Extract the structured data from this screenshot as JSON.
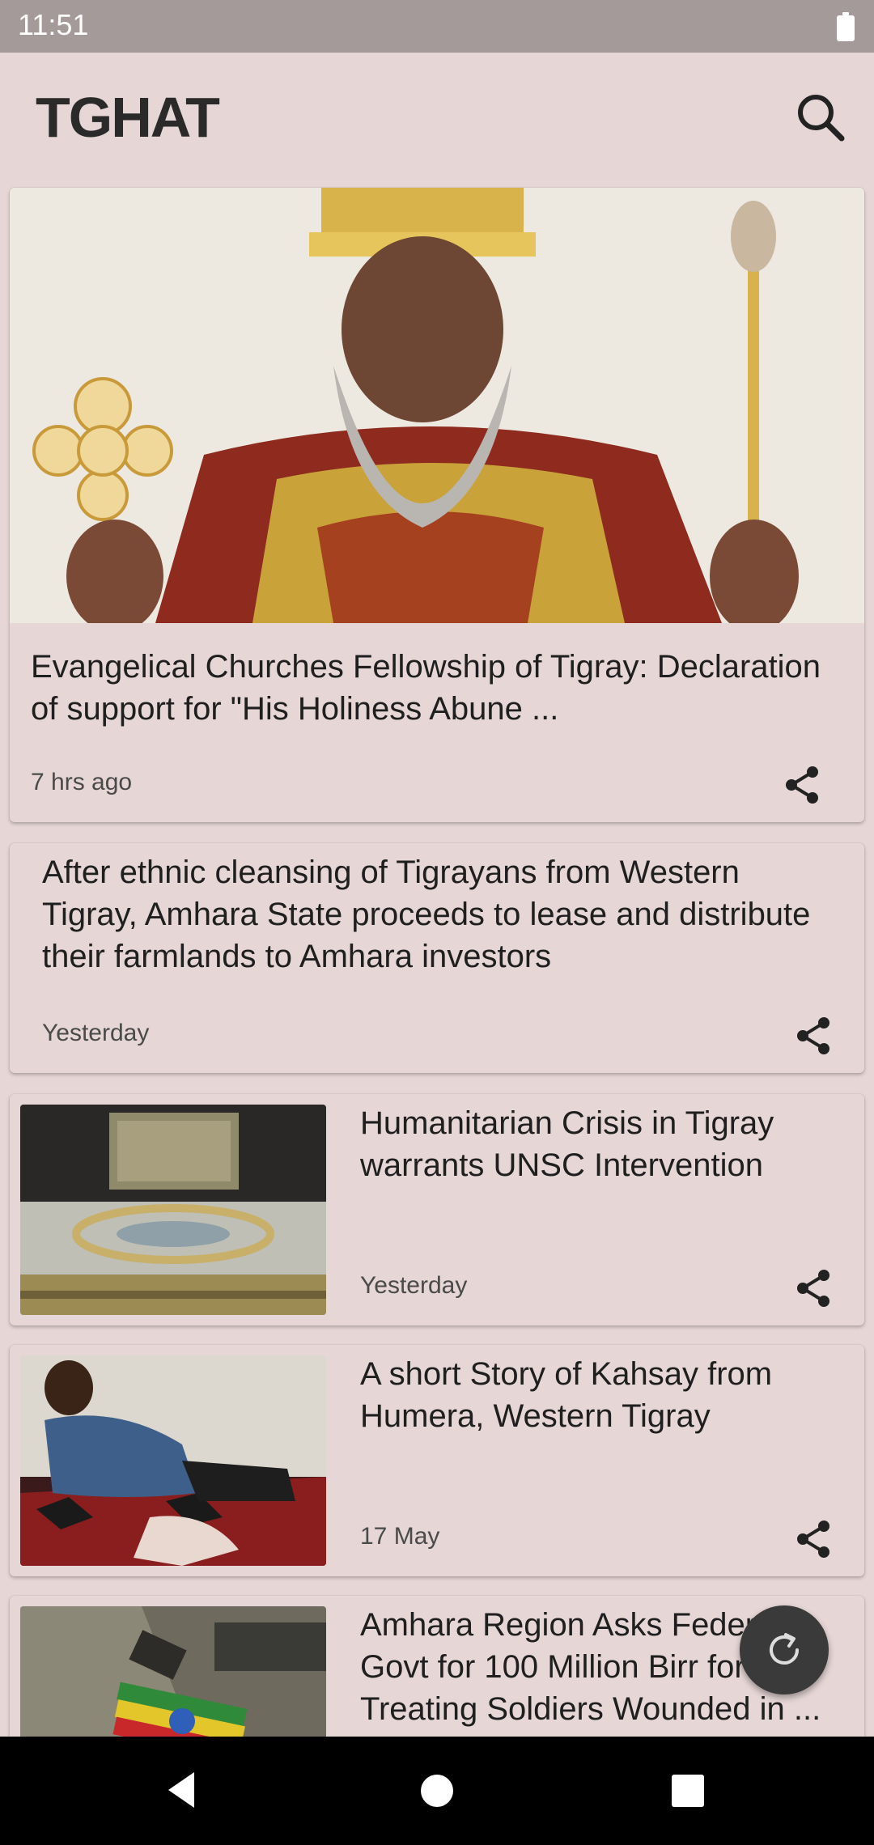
{
  "status_bar": {
    "time": "11:51"
  },
  "app_bar": {
    "title": "TGHAT"
  },
  "articles": [
    {
      "headline": "Evangelical Churches Fellowship of Tigray: Declaration of support for \"His Holiness Abune ...",
      "time": "7 hrs ago"
    },
    {
      "headline": "After ethnic cleansing of Tigrayans from Western Tigray, Amhara State proceeds to lease and distribute their farmlands to Amhara investors",
      "time": "Yesterday"
    },
    {
      "headline": "Humanitarian Crisis in Tigray warrants UNSC Intervention",
      "time": "Yesterday"
    },
    {
      "headline": "A short Story of Kahsay from Humera, Western Tigray",
      "time": "17 May"
    },
    {
      "headline": "Amhara Region Asks Federal Govt for 100 Million Birr for Treating Soldiers Wounded in ...",
      "time": ""
    }
  ],
  "icons": {
    "search": "search-icon",
    "share": "share-icon",
    "refresh": "refresh-icon",
    "battery": "battery-icon"
  },
  "colors": {
    "background": "#E6D6D6",
    "status_bar": "#A59A9A",
    "fab": "#3A3A3A",
    "nav_bar": "#000000"
  }
}
